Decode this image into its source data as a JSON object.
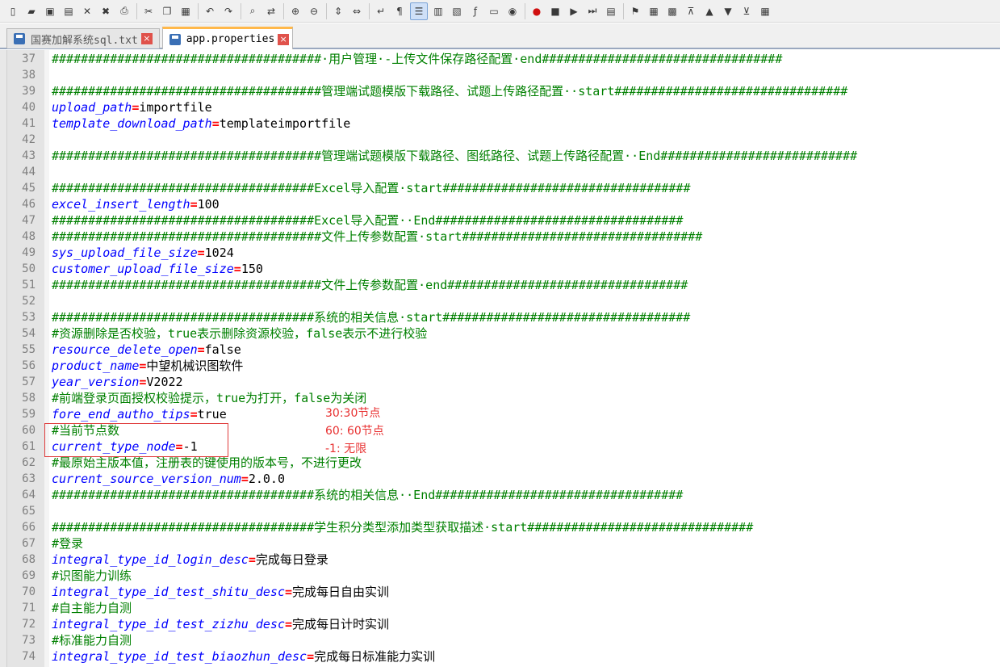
{
  "toolbar": {
    "icons": [
      "new-file-icon",
      "open-folder-icon",
      "save-icon",
      "save-all-icon",
      "close-icon",
      "close-all-icon",
      "print-icon",
      "cut-icon",
      "copy-icon",
      "paste-icon",
      "undo-icon",
      "redo-icon",
      "find-icon",
      "replace-icon",
      "zoom-in-icon",
      "zoom-out-icon",
      "sync-vertical-icon",
      "sync-horizontal-icon",
      "word-wrap-icon",
      "show-all-chars-icon",
      "indent-guide-icon",
      "udl-icon",
      "doc-map-icon",
      "function-list-icon",
      "folder-workspace-icon",
      "monitor-icon",
      "record-macro-icon",
      "stop-record-icon",
      "play-macro-icon",
      "run-macro-multiple-icon",
      "save-macro-icon",
      "bookmark-icon",
      "panel-1-icon",
      "panel-2-icon",
      "collapse-icon",
      "up-arrow-icon",
      "down-arrow-icon",
      "expand-icon",
      "grid-icon"
    ]
  },
  "tabs": [
    {
      "label": "国赛加解系统sql.txt",
      "active": false
    },
    {
      "label": "app.properties",
      "active": true
    }
  ],
  "lines": [
    {
      "n": "37",
      "tokens": [
        {
          "t": "c",
          "v": "#####################################·用户管理·-上传文件保存路径配置·end#################################"
        }
      ]
    },
    {
      "n": "38",
      "tokens": []
    },
    {
      "n": "39",
      "tokens": [
        {
          "t": "c",
          "v": "#####################################管理端试题模版下载路径、试题上传路径配置··start################################"
        }
      ]
    },
    {
      "n": "40",
      "tokens": [
        {
          "t": "k",
          "v": "upload_path"
        },
        {
          "t": "e",
          "v": "="
        },
        {
          "t": "v",
          "v": "importfile"
        }
      ]
    },
    {
      "n": "41",
      "tokens": [
        {
          "t": "k",
          "v": "template_download_path"
        },
        {
          "t": "e",
          "v": "="
        },
        {
          "t": "v",
          "v": "templateimportfile"
        }
      ]
    },
    {
      "n": "42",
      "tokens": []
    },
    {
      "n": "43",
      "tokens": [
        {
          "t": "c",
          "v": "#####################################管理端试题模版下载路径、图纸路径、试题上传路径配置··End###########################"
        }
      ]
    },
    {
      "n": "44",
      "tokens": []
    },
    {
      "n": "45",
      "tokens": [
        {
          "t": "c",
          "v": "####################################Excel导入配置·start##################################"
        }
      ]
    },
    {
      "n": "46",
      "tokens": [
        {
          "t": "k",
          "v": "excel_insert_length"
        },
        {
          "t": "e",
          "v": "="
        },
        {
          "t": "v",
          "v": "100"
        }
      ]
    },
    {
      "n": "47",
      "tokens": [
        {
          "t": "c",
          "v": "####################################Excel导入配置··End##################################"
        }
      ]
    },
    {
      "n": "48",
      "tokens": [
        {
          "t": "c",
          "v": "#####################################文件上传参数配置·start#################################"
        }
      ]
    },
    {
      "n": "49",
      "tokens": [
        {
          "t": "k",
          "v": "sys_upload_file_size"
        },
        {
          "t": "e",
          "v": "="
        },
        {
          "t": "v",
          "v": "1024"
        }
      ]
    },
    {
      "n": "50",
      "tokens": [
        {
          "t": "k",
          "v": "customer_upload_file_size"
        },
        {
          "t": "e",
          "v": "="
        },
        {
          "t": "v",
          "v": "150"
        }
      ]
    },
    {
      "n": "51",
      "tokens": [
        {
          "t": "c",
          "v": "#####################################文件上传参数配置·end#################################"
        }
      ]
    },
    {
      "n": "52",
      "tokens": []
    },
    {
      "n": "53",
      "tokens": [
        {
          "t": "c",
          "v": "####################################系统的相关信息·start##################################"
        }
      ]
    },
    {
      "n": "54",
      "tokens": [
        {
          "t": "c",
          "v": "#资源删除是否校验，true表示删除资源校验，false表示不进行校验"
        }
      ]
    },
    {
      "n": "55",
      "tokens": [
        {
          "t": "k",
          "v": "resource_delete_open"
        },
        {
          "t": "e",
          "v": "="
        },
        {
          "t": "v",
          "v": "false"
        }
      ]
    },
    {
      "n": "56",
      "tokens": [
        {
          "t": "k",
          "v": "product_name"
        },
        {
          "t": "e",
          "v": "="
        },
        {
          "t": "v",
          "v": "中望机械识图软件"
        }
      ]
    },
    {
      "n": "57",
      "tokens": [
        {
          "t": "k",
          "v": "year_version"
        },
        {
          "t": "e",
          "v": "="
        },
        {
          "t": "v",
          "v": "V2022"
        }
      ]
    },
    {
      "n": "58",
      "tokens": [
        {
          "t": "c",
          "v": "#前端登录页面授权校验提示，true为打开，false为关闭"
        }
      ]
    },
    {
      "n": "59",
      "tokens": [
        {
          "t": "k",
          "v": "fore_end_autho_tips"
        },
        {
          "t": "e",
          "v": "="
        },
        {
          "t": "v",
          "v": "true"
        }
      ]
    },
    {
      "n": "60",
      "tokens": [
        {
          "t": "c",
          "v": "#当前节点数"
        }
      ]
    },
    {
      "n": "61",
      "tokens": [
        {
          "t": "k",
          "v": "current_type_node"
        },
        {
          "t": "e",
          "v": "="
        },
        {
          "t": "v",
          "v": "-1"
        }
      ]
    },
    {
      "n": "62",
      "tokens": [
        {
          "t": "c",
          "v": "#最原始主版本值，注册表的键使用的版本号，不进行更改"
        }
      ]
    },
    {
      "n": "63",
      "tokens": [
        {
          "t": "k",
          "v": "current_source_version_num"
        },
        {
          "t": "e",
          "v": "="
        },
        {
          "t": "v",
          "v": "2.0.0"
        }
      ]
    },
    {
      "n": "64",
      "tokens": [
        {
          "t": "c",
          "v": "####################################系统的相关信息··End##################################"
        }
      ]
    },
    {
      "n": "65",
      "tokens": []
    },
    {
      "n": "66",
      "tokens": [
        {
          "t": "c",
          "v": "####################################学生积分类型添加类型获取描述·start###############################"
        }
      ]
    },
    {
      "n": "67",
      "tokens": [
        {
          "t": "c",
          "v": "#登录"
        }
      ]
    },
    {
      "n": "68",
      "tokens": [
        {
          "t": "k",
          "v": "integral_type_id_login_desc"
        },
        {
          "t": "e",
          "v": "="
        },
        {
          "t": "v",
          "v": "完成每日登录"
        }
      ]
    },
    {
      "n": "69",
      "tokens": [
        {
          "t": "c",
          "v": "#识图能力训练"
        }
      ]
    },
    {
      "n": "70",
      "tokens": [
        {
          "t": "k",
          "v": "integral_type_id_test_shitu_desc"
        },
        {
          "t": "e",
          "v": "="
        },
        {
          "t": "v",
          "v": "完成每日自由实训"
        }
      ]
    },
    {
      "n": "71",
      "tokens": [
        {
          "t": "c",
          "v": "#自主能力自测"
        }
      ]
    },
    {
      "n": "72",
      "tokens": [
        {
          "t": "k",
          "v": "integral_type_id_test_zizhu_desc"
        },
        {
          "t": "e",
          "v": "="
        },
        {
          "t": "v",
          "v": "完成每日计时实训"
        }
      ]
    },
    {
      "n": "73",
      "tokens": [
        {
          "t": "c",
          "v": "#标准能力自测"
        }
      ]
    },
    {
      "n": "74",
      "tokens": [
        {
          "t": "k",
          "v": "integral_type_id_test_biaozhun_desc"
        },
        {
          "t": "e",
          "v": "="
        },
        {
          "t": "v",
          "v": "完成每日标准能力实训"
        }
      ]
    }
  ],
  "annotation": {
    "notes": [
      "30:30节点",
      "60: 60节点",
      "-1: 无限"
    ],
    "color": "#e83030"
  },
  "colors": {
    "comment": "#008000",
    "key": "#0000ff",
    "operator": "#ff0000",
    "value": "#000000",
    "active_tab_accent": "#ffb84a"
  }
}
